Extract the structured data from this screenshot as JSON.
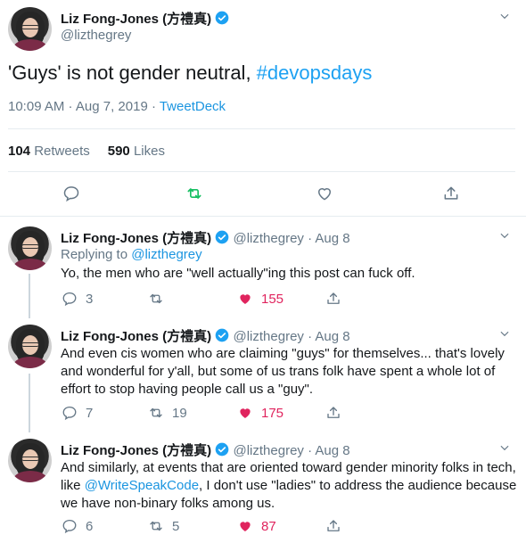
{
  "main_tweet": {
    "name": "Liz Fong-Jones (方禮真)",
    "handle": "@lizthegrey",
    "text": "'Guys' is not gender neutral, ",
    "hashtag": "#devopsdays",
    "time": "10:09 AM · Aug 7, 2019 · ",
    "source": "TweetDeck",
    "retweets": "104",
    "retweets_label": "Retweets",
    "likes": "590",
    "likes_label": "Likes"
  },
  "replies": [
    {
      "name": "Liz Fong-Jones (方禮真)",
      "meta": " @lizthegrey · Aug 8",
      "replying_prefix": "Replying to ",
      "replying_handle": "@lizthegrey",
      "text": "Yo, the men who are \"well actually\"ing this post can fuck off.",
      "reply_count": "3",
      "retweet_count": "",
      "like_count": "155"
    },
    {
      "name": "Liz Fong-Jones (方禮真)",
      "meta": " @lizthegrey · Aug 8",
      "text": "And even cis women who are claiming \"guys\" for themselves... that's lovely and wonderful for y'all, but some of us trans folk have spent a whole lot of effort to stop having people call us a \"guy\".",
      "reply_count": "7",
      "retweet_count": "19",
      "like_count": "175"
    },
    {
      "name": "Liz Fong-Jones (方禮真)",
      "meta": " @lizthegrey · Aug 8",
      "text_before": "And similarly, at events that are oriented toward gender minority folks in tech, like ",
      "mention": "@WriteSpeakCode",
      "text_after": ", I don't use \"ladies\" to address the audience because we have non-binary folks among us.",
      "reply_count": "6",
      "retweet_count": "5",
      "like_count": "87"
    }
  ],
  "colors": {
    "accent": "#1da1f2",
    "retweet_green": "#17bf63",
    "like_red": "#e0245e",
    "muted": "#657786"
  }
}
